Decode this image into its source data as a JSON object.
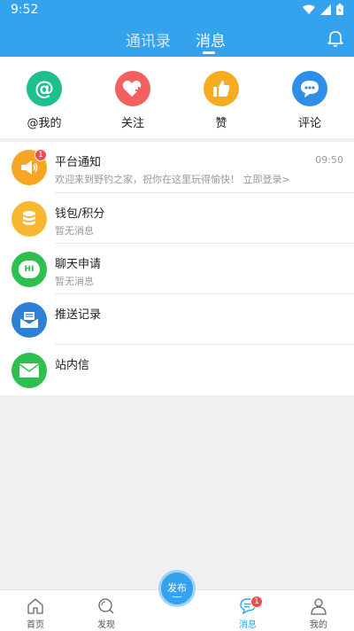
{
  "status_bar": {
    "time": "9:52"
  },
  "header": {
    "tab_contacts": "通讯录",
    "tab_messages": "消息"
  },
  "quick_actions": [
    {
      "label": "@我的",
      "icon": "at-icon",
      "color": "#1dbf8e"
    },
    {
      "label": "关注",
      "icon": "heart-plus-icon",
      "color": "#f2605f"
    },
    {
      "label": "赞",
      "icon": "thumbs-up-icon",
      "color": "#f5ad1f"
    },
    {
      "label": "评论",
      "icon": "comment-icon",
      "color": "#2f8fe8"
    }
  ],
  "messages": [
    {
      "title": "平台通知",
      "subtitle": "欢迎来到野钓之家，祝你在这里玩得愉快！ 立即登录>",
      "time": "09:50",
      "badge": "1",
      "color": "#f6a623"
    },
    {
      "title": "钱包/积分",
      "subtitle": "暂无消息",
      "color": "#f7b731"
    },
    {
      "title": "聊天申请",
      "subtitle": "暂无消息",
      "icon_text": "HI",
      "color": "#2fbf4f"
    },
    {
      "title": "推送记录",
      "subtitle": "",
      "color": "#2e7fd6"
    },
    {
      "title": "站内信",
      "subtitle": "",
      "color": "#2fbf4f"
    }
  ],
  "bottom_nav": {
    "home": "首页",
    "discover": "发现",
    "publish": "发布",
    "messages": "消息",
    "messages_badge": "1",
    "mine": "我的"
  }
}
